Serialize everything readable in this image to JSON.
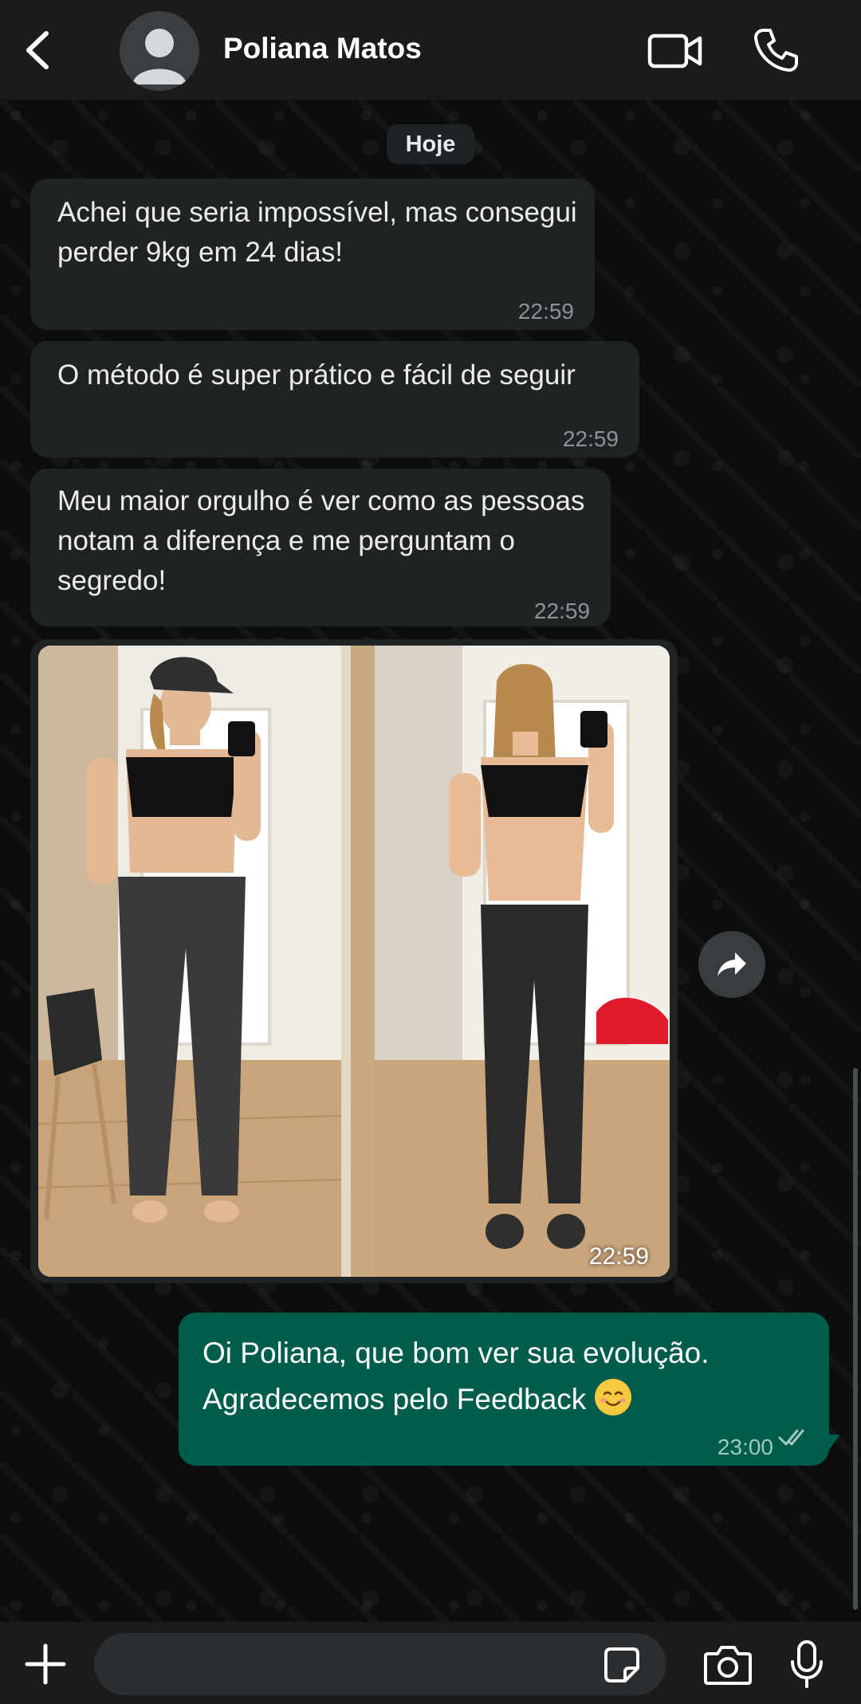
{
  "header": {
    "contact_name": "Poliana Matos"
  },
  "chat": {
    "date_label": "Hoje",
    "incoming": [
      {
        "text": "Achei que seria impossível, mas consegui perder 9kg em 24 dias!",
        "time": "22:59"
      },
      {
        "text": "O método é super prático e fácil de seguir",
        "time": "22:59"
      },
      {
        "text": "Meu maior orgulho é ver como as pessoas notam a diferença e me perguntam o segredo!",
        "time": "22:59"
      }
    ],
    "photo_message": {
      "time": "22:59"
    },
    "outgoing": {
      "text": "Oi Poliana, que bom ver sua evolução. Agradecemos pelo Feedback",
      "emoji": "smiling-face-emoji",
      "time": "23:00",
      "status": "read"
    }
  },
  "composer": {
    "placeholder": "",
    "value": ""
  },
  "colors": {
    "header_bg": "#1b1b1b",
    "incoming_bubble": "#202324",
    "outgoing_bubble": "#005c4b",
    "read_ticks": "#9fc9bf"
  }
}
